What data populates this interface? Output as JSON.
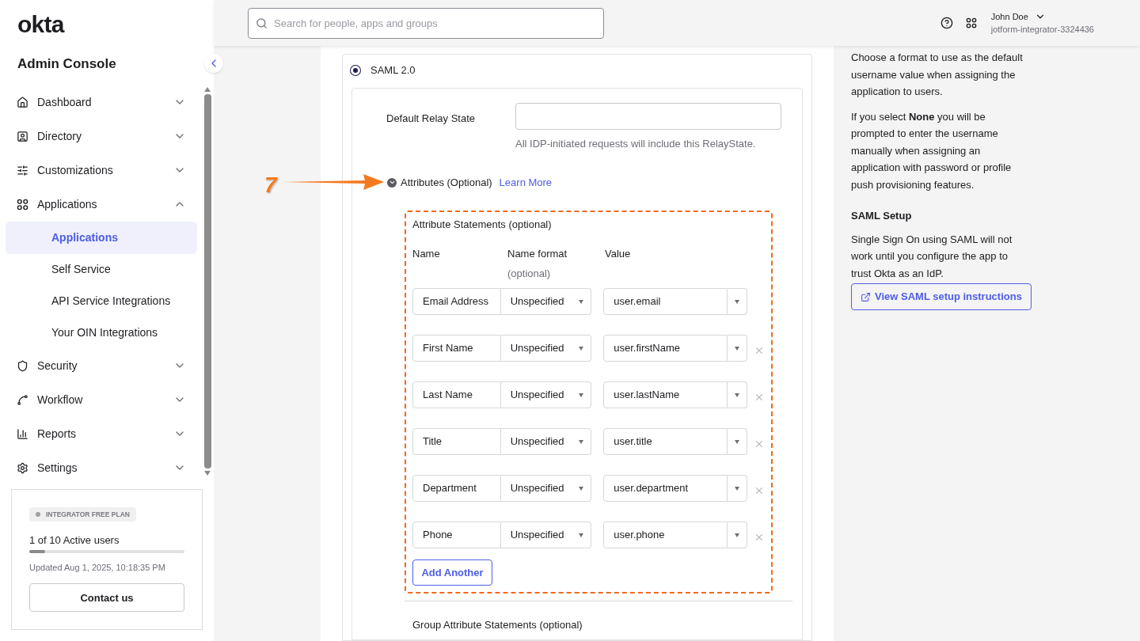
{
  "sidebar": {
    "logo": "okta",
    "title": "Admin Console",
    "items": [
      {
        "label": "Dashboard",
        "expanded": false
      },
      {
        "label": "Directory",
        "expanded": false
      },
      {
        "label": "Customizations",
        "expanded": false
      },
      {
        "label": "Applications",
        "expanded": true,
        "children": [
          {
            "label": "Applications",
            "selected": true
          },
          {
            "label": "Self Service",
            "selected": false
          },
          {
            "label": "API Service Integrations",
            "selected": false
          },
          {
            "label": "Your OIN Integrations",
            "selected": false
          }
        ]
      },
      {
        "label": "Security",
        "expanded": false
      },
      {
        "label": "Workflow",
        "expanded": false
      },
      {
        "label": "Reports",
        "expanded": false
      },
      {
        "label": "Settings",
        "expanded": false
      }
    ],
    "plan": {
      "badge": "INTEGRATOR FREE PLAN",
      "users": "1 of 10 Active users",
      "level": 0.1,
      "updated": "Updated Aug 1, 2025, 10:18:35 PM",
      "button": "Contact us"
    }
  },
  "header": {
    "search": {
      "placeholder": "Search for people, apps and groups"
    },
    "user": {
      "name": "John Doe",
      "org": "jotform-integrator-3324436"
    }
  },
  "saml": {
    "option": {
      "label": "SAML 2.0",
      "selected": true
    },
    "relay_state": {
      "label": "Default Relay State",
      "hint": "All IDP-initiated requests will include this RelayState."
    },
    "attributes": {
      "label": "Attributes (Optional)",
      "expanded": true,
      "link": "Learn More",
      "annotation": "7",
      "title": "Attribute Statements (optional)",
      "columns": [
        "Name",
        "Name format",
        "Value"
      ],
      "column_note": "(optional)",
      "rows": [
        {
          "name": "Email Address",
          "format": "Unspecified",
          "value": "user.email",
          "removable": false
        },
        {
          "name": "First Name",
          "format": "Unspecified",
          "value": "user.firstName",
          "removable": true
        },
        {
          "name": "Last Name",
          "format": "Unspecified",
          "value": "user.lastName",
          "removable": true
        },
        {
          "name": "Title",
          "format": "Unspecified",
          "value": "user.title",
          "removable": true
        },
        {
          "name": "Department",
          "format": "Unspecified",
          "value": "user.department",
          "removable": true
        },
        {
          "name": "Phone",
          "format": "Unspecified",
          "value": "user.phone",
          "removable": true
        }
      ],
      "add_button": "Add Another"
    },
    "group_title": "Group Attribute Statements (optional)"
  },
  "help": {
    "paragraphs": [
      "Choose a format to use as the default username value when assigning the application to users.",
      "If you select **None** you will be prompted to enter the username manually when assigning an application with password or profile push provisioning features."
    ],
    "heading": "SAML Setup",
    "text": "Single Sign On using SAML will not work until you configure the app to trust Okta as an IdP.",
    "button": "View SAML setup instructions"
  }
}
